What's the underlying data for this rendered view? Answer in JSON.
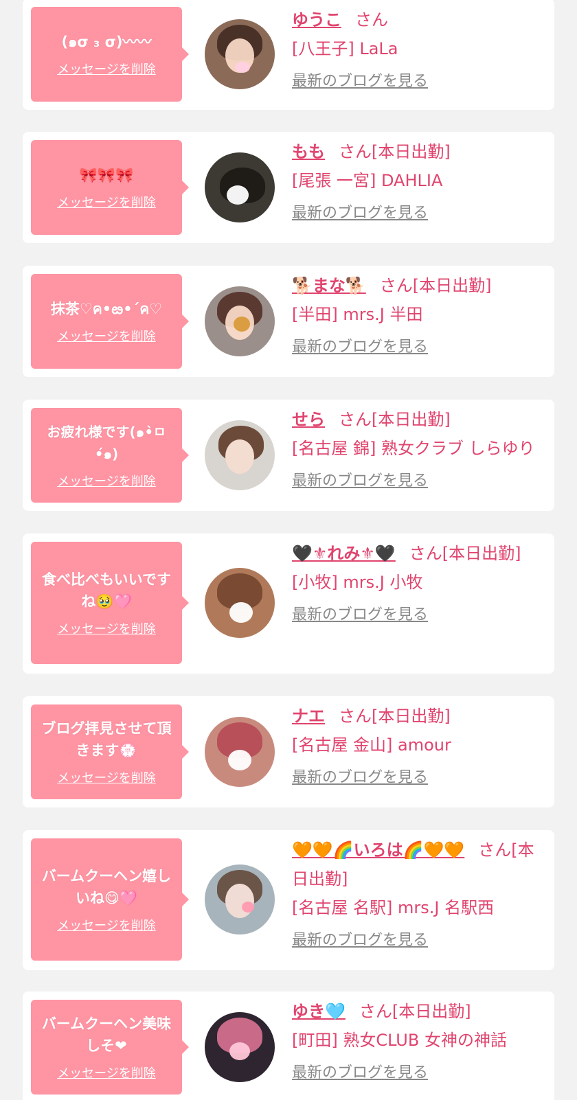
{
  "delete_label": "メッセージを削除",
  "blog_label": "最新のブログを見る",
  "san": "さん",
  "entries": [
    {
      "message": "(๑σ ₃ σ)〰〰",
      "name": "ゆうこ",
      "status": "",
      "shop": "[八王子] LaLa"
    },
    {
      "message": "🎀🎀🎀",
      "name": "もも",
      "status": "[本日出勤]",
      "shop": "[尾張 一宮] DAHLIA"
    },
    {
      "message": "抹茶♡ค•ఴ•´ค♡",
      "name": "🐕まな🐕",
      "status": "[本日出勤]",
      "shop": "[半田] mrs.J 半田"
    },
    {
      "message": "お疲れ様です(๑•̀ㅁ•́๑)",
      "name": "せら",
      "status": "[本日出勤]",
      "shop": "[名古屋 錦] 熟女クラブ しらゆり"
    },
    {
      "message": "食べ比べもいいですね🥹🩷",
      "name": "🖤⚜れみ⚜🖤",
      "status": "[本日出勤]",
      "shop": "[小牧] mrs.J 小牧"
    },
    {
      "message": "ブログ拝見させて頂きます💮",
      "name": "ナエ",
      "status": "[本日出勤]",
      "shop": "[名古屋 金山] amour"
    },
    {
      "message": "バームクーヘン嬉しいね😋🩷",
      "name": "🧡🧡🌈いろは🌈🧡🧡",
      "status": "[本日出勤]",
      "shop": "[名古屋 名駅] mrs.J 名駅西"
    },
    {
      "message": "バームクーヘン美味しそ❤",
      "name": "ゆき🩵",
      "status": "[本日出勤]",
      "shop": "[町田] 熟女CLUB 女神の神話"
    }
  ]
}
